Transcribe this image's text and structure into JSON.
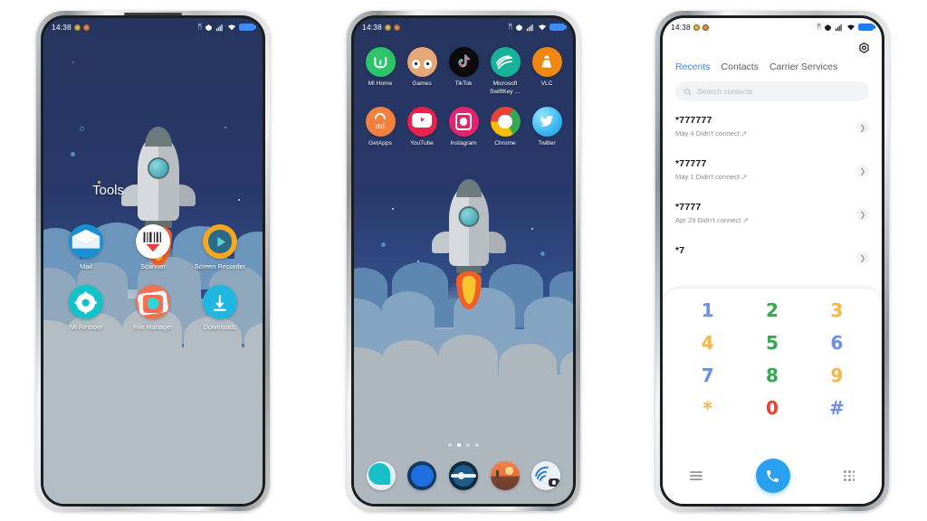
{
  "page": {
    "background": "#ffffff"
  },
  "status_bar": {
    "time": "14:38",
    "icons": [
      "bluetooth-icon",
      "vpn-icon",
      "signal-icon",
      "wifi-icon",
      "battery-icon"
    ],
    "bluetooth_glyph": "ᛗ",
    "wifi_glyph": "▲",
    "dot_a_color": "#dcb84a",
    "dot_b_color": "#e08a52",
    "battery_color_dark": "#3d8bfd",
    "battery_color_light": "#1b7ef5"
  },
  "phone1": {
    "name": "tools-folder-screen",
    "folder_title": "Tools",
    "apps": [
      {
        "label": "Mail",
        "icon": "mail-icon",
        "color": "#1a8fd1"
      },
      {
        "label": "Scanner",
        "icon": "scanner-icon",
        "color": "#ffffff"
      },
      {
        "label": "Screen Recorder",
        "icon": "screen-recorder-icon",
        "color": "#f5a623"
      },
      {
        "label": "Mi Remote",
        "icon": "mi-remote-icon",
        "color": "#12c2c9"
      },
      {
        "label": "File Manager",
        "icon": "file-manager-icon",
        "color": "#f4714f"
      },
      {
        "label": "Downloads",
        "icon": "downloads-icon",
        "color": "#1fb6e0"
      }
    ]
  },
  "phone2": {
    "name": "home-screen",
    "apps": [
      {
        "label": "Mi Home",
        "icon": "mi-home-icon",
        "color": "#2ec46a"
      },
      {
        "label": "Games",
        "icon": "games-icon",
        "color": "#e5a878"
      },
      {
        "label": "TikTok",
        "icon": "tiktok-icon",
        "color": "#0b0b0e"
      },
      {
        "label": "Microsoft SwiftKey …",
        "icon": "swiftkey-icon",
        "color": "#16b39a"
      },
      {
        "label": "VLC",
        "icon": "vlc-icon",
        "color": "#f08711"
      },
      {
        "label": "GetApps",
        "icon": "getapps-icon",
        "color": "#f2813f"
      },
      {
        "label": "YouTube",
        "icon": "youtube-icon",
        "color": "#e8224a"
      },
      {
        "label": "Instagram",
        "icon": "instagram-icon",
        "color": "#e1256d"
      },
      {
        "label": "Chrome",
        "icon": "chrome-icon",
        "color": "#f6c21c"
      },
      {
        "label": "Twitter",
        "icon": "twitter-icon",
        "color": "#38b6f0"
      }
    ],
    "page_dots": {
      "count": 4,
      "active_index": 1
    },
    "dock": [
      {
        "icon": "messaging-icon",
        "color": "#17c0c8"
      },
      {
        "icon": "browser-icon",
        "color": "#1f6fe0"
      },
      {
        "icon": "settings-icon",
        "color": "#1d5c86"
      },
      {
        "icon": "gallery-icon",
        "color": "#f0753a"
      },
      {
        "icon": "camera-icon",
        "color": "#2b7fd0"
      }
    ]
  },
  "phone3": {
    "name": "dialer-screen",
    "settings_icon": "gear-icon",
    "tabs": [
      {
        "label": "Recents",
        "active": true
      },
      {
        "label": "Contacts",
        "active": false
      },
      {
        "label": "Carrier Services",
        "active": false
      }
    ],
    "search": {
      "placeholder": "Search contacts",
      "value": "",
      "icon": "search-icon"
    },
    "calls": [
      {
        "number": "*777777",
        "detail": "May 4 Didn't connect",
        "direction": "outgoing-icon"
      },
      {
        "number": "*77777",
        "detail": "May 1 Didn't connect",
        "direction": "outgoing-icon"
      },
      {
        "number": "*7777",
        "detail": "Apr 29 Didn't connect",
        "direction": "outgoing-icon"
      },
      {
        "number": "*7",
        "detail": "",
        "direction": "outgoing-icon"
      }
    ],
    "keypad": [
      {
        "key": "1",
        "color": "#6f8fe8"
      },
      {
        "key": "2",
        "color": "#34a853"
      },
      {
        "key": "3",
        "color": "#f5b945"
      },
      {
        "key": "4",
        "color": "#f5b945"
      },
      {
        "key": "5",
        "color": "#34a853"
      },
      {
        "key": "6",
        "color": "#6f8fe8"
      },
      {
        "key": "7",
        "color": "#6f8fe8"
      },
      {
        "key": "8",
        "color": "#34a853"
      },
      {
        "key": "9",
        "color": "#f5b945"
      },
      {
        "key": "*",
        "color": "#f5b945"
      },
      {
        "key": "0",
        "color": "#ea4335"
      },
      {
        "key": "#",
        "color": "#6f8fe8"
      }
    ],
    "bottom_bar": {
      "menu_icon": "hamburger-menu-icon",
      "call_icon": "phone-call-icon",
      "call_color": "#29a1f0",
      "keypad_icon": "dialpad-icon"
    }
  }
}
